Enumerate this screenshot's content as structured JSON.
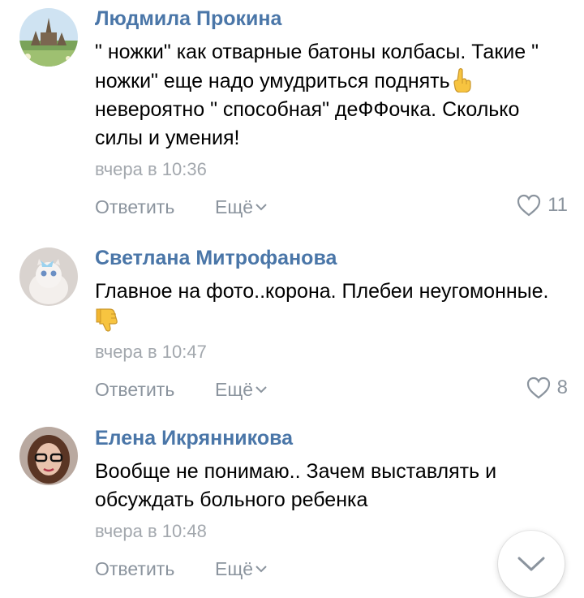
{
  "comments": [
    {
      "author": "Людмила Прокина",
      "text_part1": "\" ножки\" как отварные батоны колбасы. Такие \" ножки\" еще надо умудриться поднять",
      "emoji": "pointing-up-emoji",
      "text_part2": " невероятно \" способная\" деФФочка. Сколько силы и умения!",
      "time": "вчера в 10:36",
      "reply_label": "Ответить",
      "more_label": "Ещё",
      "likes": "11"
    },
    {
      "author": "Светлана Митрофанова",
      "text_part1": "Главное на фото..корона. Плебеи неугомонные.",
      "emoji": "thumbs-down-emoji",
      "text_part2": "",
      "time": "вчера в 10:47",
      "reply_label": "Ответить",
      "more_label": "Ещё",
      "likes": "8"
    },
    {
      "author": "Елена Икрянникова",
      "text_part1": "Вообще не понимаю.. Зачем выставлять и обсуждать больного ребенка",
      "emoji": "",
      "text_part2": "",
      "time": "вчера в 10:48",
      "reply_label": "Ответить",
      "more_label": "Ещё",
      "likes": ""
    }
  ],
  "icons": {
    "like": "heart-outline-icon",
    "more_chevron": "chevron-down-icon",
    "scroll": "chevron-down-icon"
  },
  "colors": {
    "author": "#4a76a8",
    "secondary": "#8b949e",
    "time": "#a3a8ae"
  }
}
